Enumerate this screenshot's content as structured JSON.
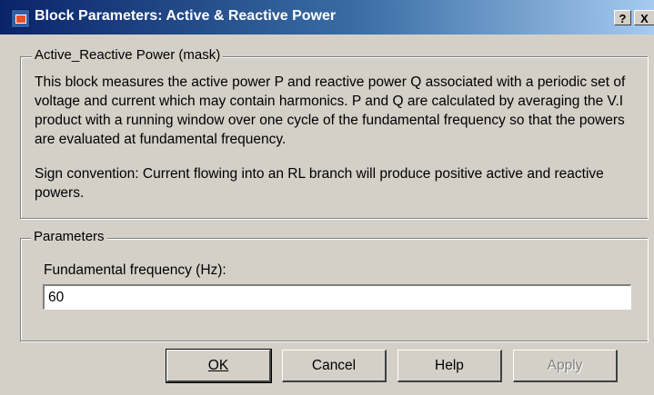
{
  "window": {
    "title": "Block Parameters: Active & Reactive Power",
    "help_glyph": "?",
    "close_glyph": "X"
  },
  "description": {
    "legend": "Active_Reactive Power (mask)",
    "paragraph1": "This block measures the active power P and reactive power Q  associated with a periodic  set of voltage and current which may contain harmonics. P and Q are calculated by averaging the V.I product with a running window over one cycle of the fundamental frequency so that the powers are evaluated at fundamental frequency.",
    "paragraph2": "Sign convention: Current flowing into an RL branch will produce positive active and reactive powers."
  },
  "parameters": {
    "legend": "Parameters",
    "frequency_label": "Fundamental frequency (Hz):",
    "frequency_value": "60"
  },
  "buttons": {
    "ok": "OK",
    "cancel": "Cancel",
    "help": "Help",
    "apply": "Apply"
  },
  "colors": {
    "titlebar_start": "#0a246a",
    "titlebar_end": "#a6caf0",
    "dialog_face": "#d4d0c8"
  }
}
